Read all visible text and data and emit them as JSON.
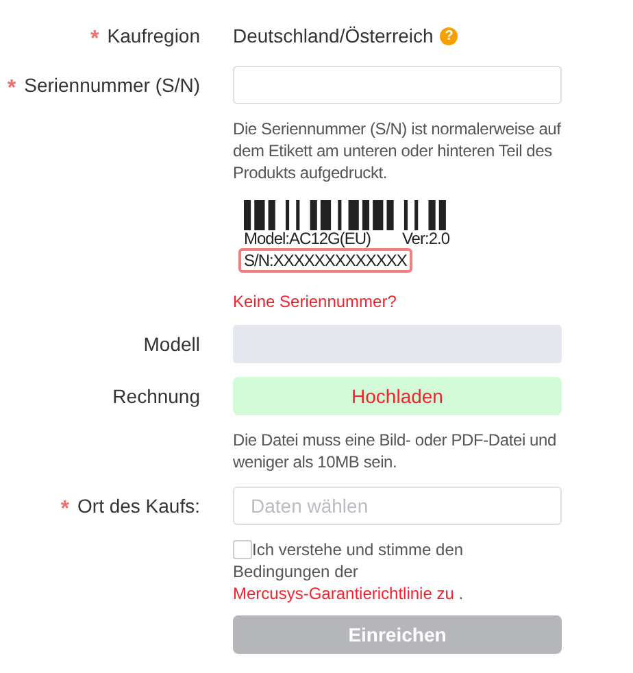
{
  "fields": [
    {
      "kind": "text",
      "label": "Kaufregion",
      "required_mark": "*",
      "value": "Deutschland/Österreich",
      "help_icon": "?"
    },
    {
      "kind": "input",
      "label": "Seriennummer (S/N)",
      "required_mark": "*",
      "disabled": false,
      "hint": "Die Seriennummer (S/N) ist normalerweise auf dem Etikett am unteren oder hinteren Teil des Produkts aufgedruckt.",
      "sample": {
        "model": "Model:AC12G(EU)",
        "version": "Ver:2.0",
        "serial": "S/N:XXXXXXXXXXXXX"
      },
      "link": "Keine Seriennummer?"
    },
    {
      "kind": "input",
      "label": "Modell",
      "disabled": true
    },
    {
      "kind": "upload",
      "label": "Rechnung",
      "button": "Hochladen",
      "hint": "Die Datei muss eine Bild- oder PDF-Datei und weniger als 10MB sein."
    },
    {
      "kind": "input",
      "label": "Ort des Kaufs:",
      "required_mark": "*",
      "disabled": false,
      "placeholder": "Daten wählen"
    }
  ],
  "consent": {
    "checked": false,
    "text": "Ich verstehe und stimme den Bedingungen der ",
    "link": "Mercusys-Garantierichtlinie zu",
    "after": " ."
  },
  "submit": {
    "label": "Einreichen",
    "disabled": true
  }
}
